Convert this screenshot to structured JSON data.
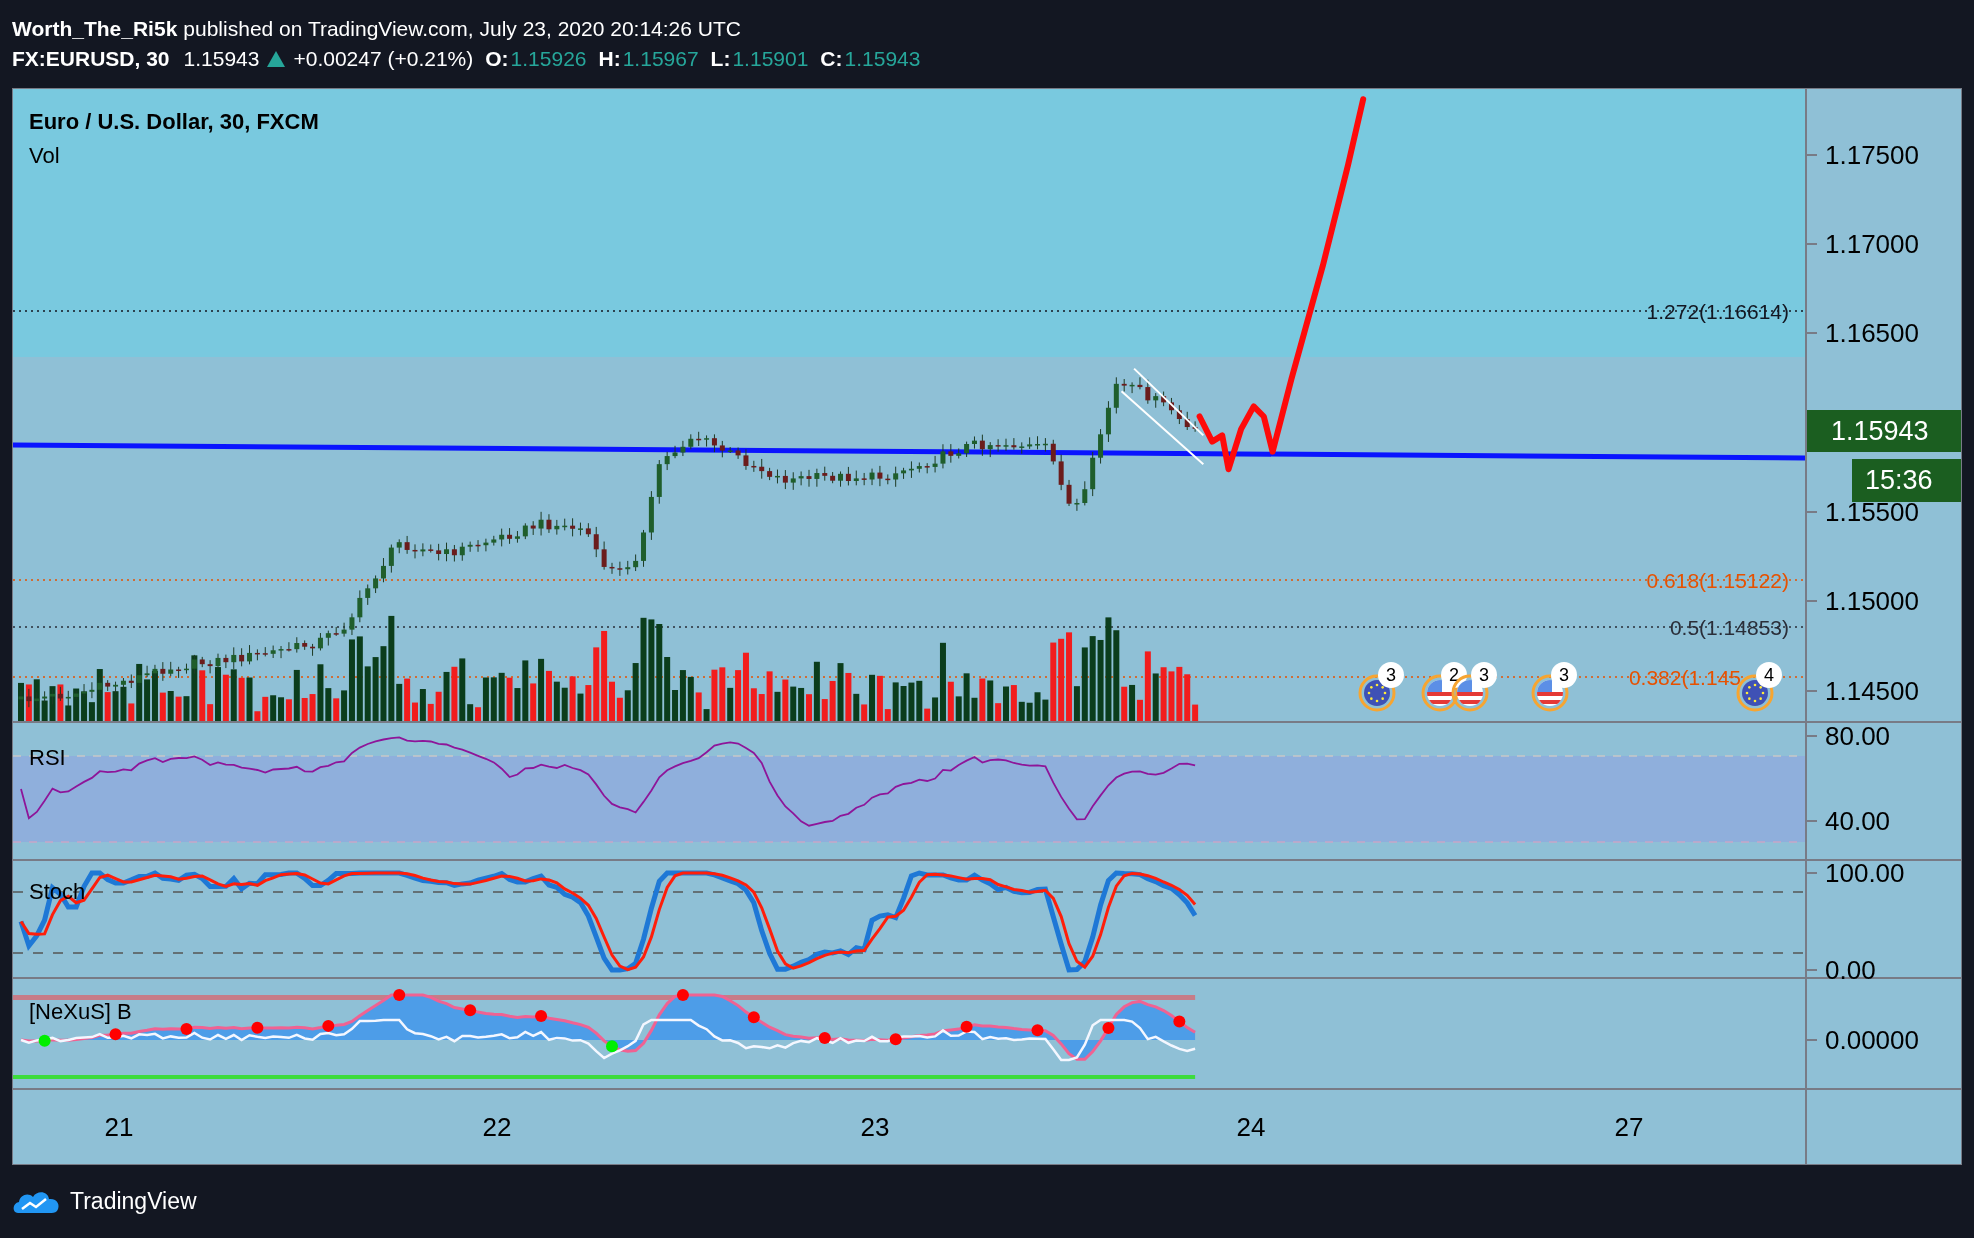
{
  "header": {
    "author": "Worth_The_Ri5k",
    "published": "published on TradingView.com, July 23, 2020 20:14:26 UTC"
  },
  "ticker": {
    "symbol": "FX:EURUSD, 30",
    "last": "1.15943",
    "change": "+0.00247 (+0.21%)",
    "ohlc": [
      {
        "label": "O:",
        "value": "1.15926"
      },
      {
        "label": "H:",
        "value": "1.15967"
      },
      {
        "label": "L:",
        "value": "1.15901"
      },
      {
        "label": "C:",
        "value": "1.15943"
      }
    ]
  },
  "chart": {
    "title": "Euro / U.S. Dollar, 30, FXCM",
    "volume_label": "Vol",
    "fib_levels": [
      {
        "label": "1.272(1.16614)",
        "color": "#131722"
      },
      {
        "label": "0.618(1.15122)",
        "color": "#e65100"
      },
      {
        "label": "0.5(1.14853)",
        "color": "#2a2e39"
      },
      {
        "label": "0.382(1.145",
        "color": "#e65100"
      }
    ],
    "events": [
      {
        "kind": "eu",
        "count": "3"
      },
      {
        "kind": "us",
        "count": "2"
      },
      {
        "kind": "us",
        "count": "3"
      },
      {
        "kind": "us",
        "count": "3"
      },
      {
        "kind": "eu",
        "count": "4"
      }
    ],
    "price_axis": [
      "1.17500",
      "1.17000",
      "1.16500",
      "1.15500",
      "1.15000",
      "1.14500"
    ],
    "current_price": "1.15943",
    "countdown": "15:36"
  },
  "rsi": {
    "title": "RSI",
    "axis": [
      "80.00",
      "40.00"
    ]
  },
  "stoch": {
    "title": "Stoch",
    "axis": [
      "100.00",
      "0.00"
    ]
  },
  "nexus": {
    "title": "[NeXuS] B",
    "axis": [
      "0.00000"
    ]
  },
  "time_axis": [
    "21",
    "22",
    "23",
    "24",
    "27"
  ],
  "footer": {
    "brand": "TradingView"
  }
}
